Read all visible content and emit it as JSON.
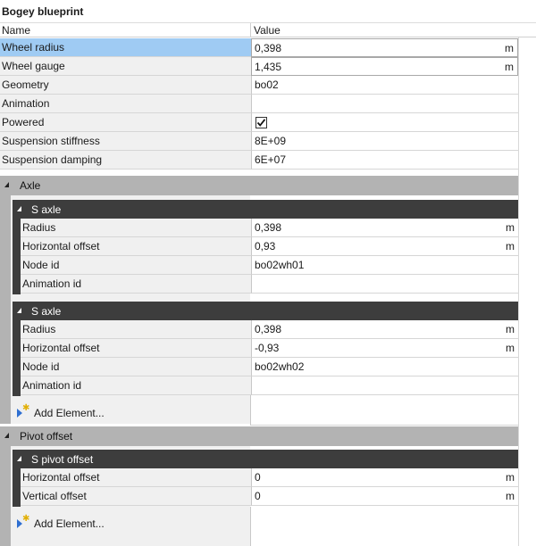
{
  "title": "Bogey blueprint",
  "columns": {
    "name": "Name",
    "value": "Value"
  },
  "top_rows": [
    {
      "name": "Wheel radius",
      "value": "0,398",
      "unit": "m"
    },
    {
      "name": "Wheel gauge",
      "value": "1,435",
      "unit": "m"
    },
    {
      "name": "Geometry",
      "value": "bo02",
      "unit": ""
    },
    {
      "name": "Animation",
      "value": "",
      "unit": ""
    },
    {
      "name": "Powered",
      "value": "",
      "unit": "",
      "checked": true
    },
    {
      "name": "Suspension stiffness",
      "value": "8E+09",
      "unit": ""
    },
    {
      "name": "Suspension damping",
      "value": "6E+07",
      "unit": ""
    }
  ],
  "axle_group": {
    "label": "Axle",
    "items": [
      {
        "label": "S axle",
        "rows": [
          {
            "name": "Radius",
            "value": "0,398",
            "unit": "m"
          },
          {
            "name": "Horizontal offset",
            "value": "0,93",
            "unit": "m"
          },
          {
            "name": "Node id",
            "value": "bo02wh01",
            "unit": ""
          },
          {
            "name": "Animation id",
            "value": "",
            "unit": ""
          }
        ]
      },
      {
        "label": "S axle",
        "rows": [
          {
            "name": "Radius",
            "value": "0,398",
            "unit": "m"
          },
          {
            "name": "Horizontal offset",
            "value": "-0,93",
            "unit": "m"
          },
          {
            "name": "Node id",
            "value": "bo02wh02",
            "unit": ""
          },
          {
            "name": "Animation id",
            "value": "",
            "unit": ""
          }
        ]
      }
    ],
    "add_label": "Add Element..."
  },
  "pivot_group": {
    "label": "Pivot offset",
    "items": [
      {
        "label": "S pivot offset",
        "rows": [
          {
            "name": "Horizontal offset",
            "value": "0",
            "unit": "m"
          },
          {
            "name": "Vertical offset",
            "value": "0",
            "unit": "m"
          }
        ]
      }
    ],
    "add_label": "Add Element..."
  }
}
